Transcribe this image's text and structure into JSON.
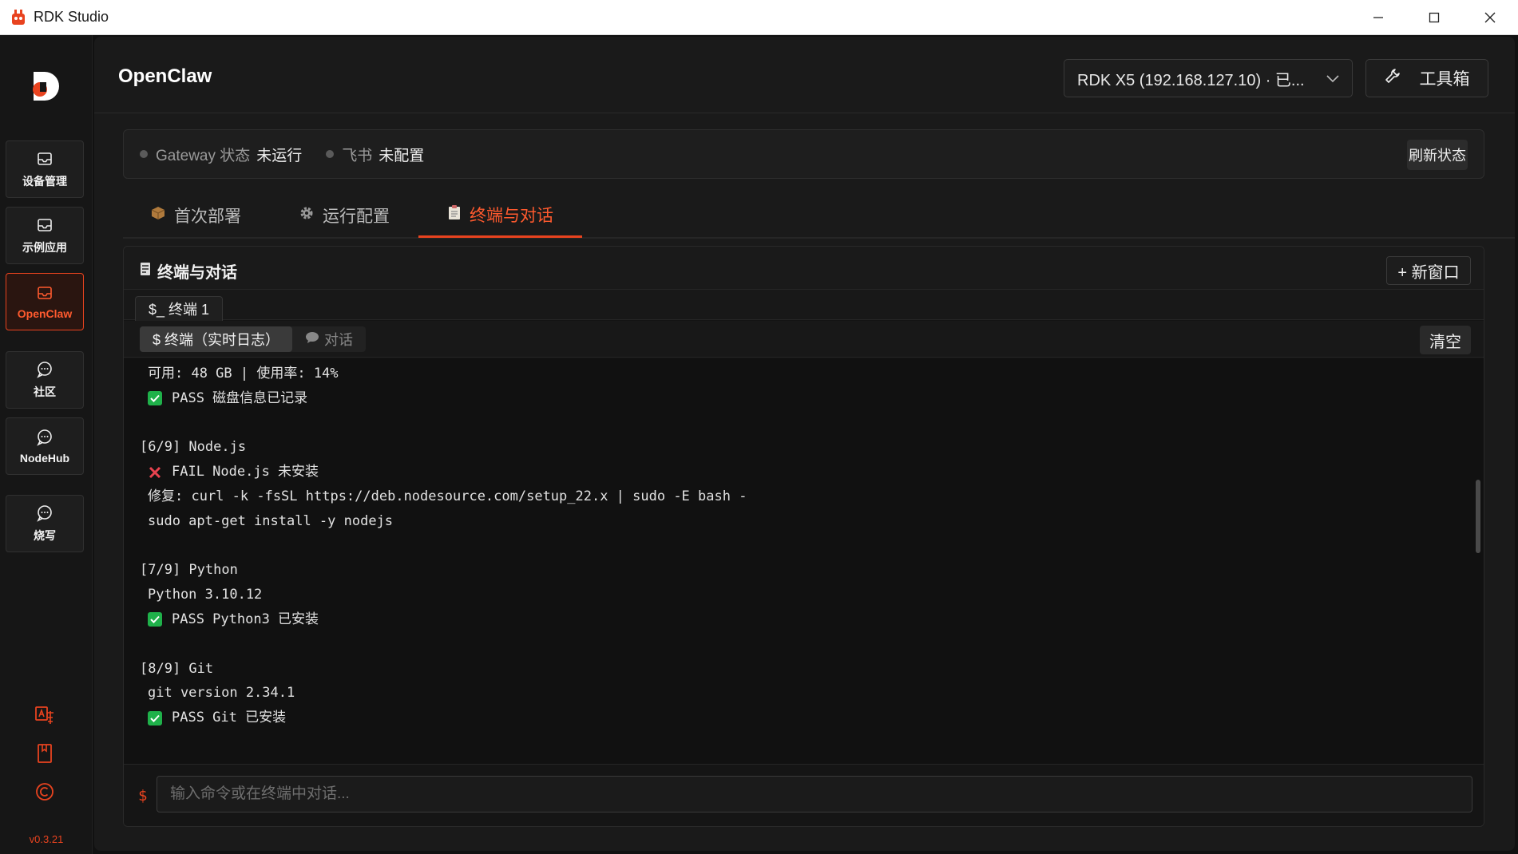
{
  "window": {
    "title": "RDK Studio"
  },
  "sidebar": {
    "items": [
      {
        "label": "设备管理"
      },
      {
        "label": "示例应用"
      },
      {
        "label": "OpenClaw"
      },
      {
        "label": "社区"
      },
      {
        "label": "NodeHub"
      },
      {
        "label": "烧写"
      }
    ],
    "active_index": 2,
    "version": "v0.3.21"
  },
  "header": {
    "title": "OpenClaw",
    "device_select": "RDK X5 (192.168.127.10) · 已...",
    "toolbox_label": "工具箱"
  },
  "status": {
    "gateway_key": "Gateway 状态",
    "gateway_val": "未运行",
    "feishu_key": "飞书",
    "feishu_val": "未配置",
    "refresh_label": "刷新状态"
  },
  "tabs": [
    {
      "label": "首次部署",
      "icon": "package-icon"
    },
    {
      "label": "运行配置",
      "icon": "gear-icon"
    },
    {
      "label": "终端与对话",
      "icon": "clipboard-icon"
    }
  ],
  "active_tab": 2,
  "panel": {
    "title": "终端与对话",
    "new_window_label": "+ 新窗口",
    "terminal_tab": "$_  终端 1",
    "mode_terminal": "$ 终端（实时日志）",
    "mode_chat": "对话",
    "clear_label": "清空",
    "input_prompt": "$",
    "input_placeholder": "输入命令或在终端中对话..."
  },
  "terminal": {
    "lines": [
      {
        "text": "可用: 48 GB | 使用率: 14%",
        "kind": "ind"
      },
      {
        "text": "PASS 磁盘信息已记录",
        "kind": "pass"
      },
      {
        "text": "",
        "kind": "blank"
      },
      {
        "text": "[6/9] Node.js",
        "kind": "plain"
      },
      {
        "text": "FAIL Node.js 未安装",
        "kind": "fail"
      },
      {
        "text": "修复: curl -k -fsSL https://deb.nodesource.com/setup_22.x | sudo -E bash -",
        "kind": "ind"
      },
      {
        "text": "sudo apt-get install -y nodejs",
        "kind": "ind"
      },
      {
        "text": "",
        "kind": "blank"
      },
      {
        "text": "[7/9] Python",
        "kind": "plain"
      },
      {
        "text": "Python 3.10.12",
        "kind": "ind"
      },
      {
        "text": "PASS Python3 已安装",
        "kind": "pass"
      },
      {
        "text": "",
        "kind": "blank"
      },
      {
        "text": "[8/9] Git",
        "kind": "plain"
      },
      {
        "text": "git version 2.34.1",
        "kind": "ind"
      },
      {
        "text": "PASS Git 已安装",
        "kind": "pass"
      }
    ]
  },
  "colors": {
    "accent": "#e8431f",
    "pass": "#1fb14a",
    "fail": "#e8434f"
  }
}
